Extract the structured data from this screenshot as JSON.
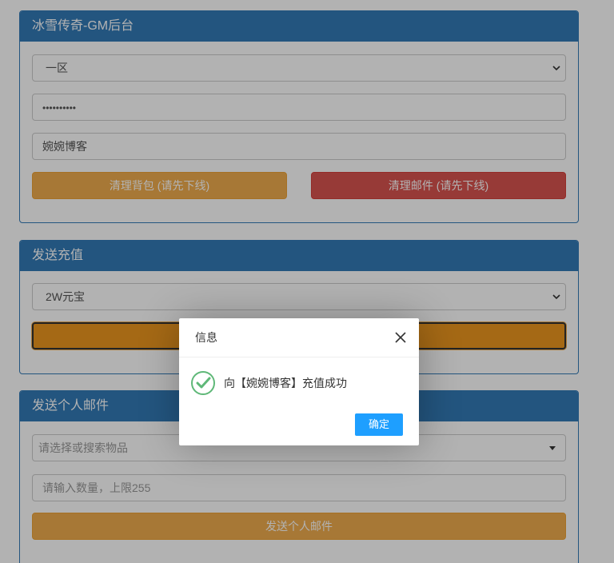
{
  "panels": {
    "gm": {
      "title": "冰雪传奇-GM后台",
      "server_select": "一区",
      "password_value": "••••••••••",
      "player_name": "婉婉博客",
      "clear_bag_label": "清理背包 (请先下线)",
      "clear_mail_label": "清理邮件 (请先下线)"
    },
    "recharge": {
      "title": "发送充值",
      "amount_select": "2W元宝"
    },
    "mail": {
      "title": "发送个人邮件",
      "item_placeholder": "请选择或搜索物品",
      "quantity_placeholder": "请输入数量，上限255",
      "send_label": "发送个人邮件"
    }
  },
  "dialog": {
    "title": "信息",
    "message": "向【婉婉博客】充值成功",
    "confirm_label": "确定",
    "icons": {
      "close": "close-icon",
      "status": "success-check-icon"
    },
    "colors": {
      "confirm": "#1e9fff",
      "success": "#5fb878"
    }
  },
  "colors": {
    "panel_primary": "#337ab7",
    "warning": "#f0ad4e",
    "danger": "#d9534f"
  }
}
